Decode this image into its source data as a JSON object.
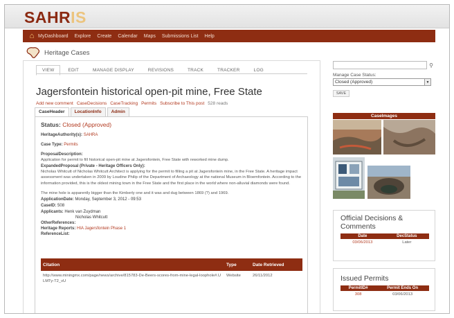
{
  "app": {
    "logo_main": "SAHR",
    "logo_accent": "IS"
  },
  "nav": {
    "items": [
      "MyDashboard",
      "Explore",
      "Create",
      "Calendar",
      "Maps",
      "Submissions List",
      "Help"
    ]
  },
  "section": {
    "title": "Heritage Cases"
  },
  "tabs": [
    "VIEW",
    "EDIT",
    "MANAGE DISPLAY",
    "REVISIONS",
    "TRACK",
    "TRACKER",
    "LOG"
  ],
  "page": {
    "title": "Jagersfontein historical open-pit mine, Free State",
    "actions": [
      "Add new comment",
      "CaseDecisions",
      "CaseTracking",
      "Permits",
      "Subscribe to This post"
    ],
    "reads": "528 reads"
  },
  "subtabs": [
    "CaseHeader",
    "LocationInfo",
    "Admin"
  ],
  "case": {
    "status_label": "Status:",
    "status_value": "Closed (Approved)",
    "authority_label": "HeritageAuthority(s):",
    "authority_value": "SAHRA",
    "casetype_label": "Case Type:",
    "casetype_value": "Permits",
    "proposal_label": "ProposalDescription:",
    "proposal_text": "Application for permit to fill historical open-pit mine at Jagersfontein, Free State with reworked mine dump.",
    "expanded_label": "ExpandedProposal (Private - Heritage Officers Only):",
    "expanded_text_1": "Nicholas Whitcutt of Nicholas Whitcutt Architect is applying for the permit to filling a pit at Jagersfontein mine, in the Free State. A heritage impact assessment was undertaken in 2009 by Loudine Philip of the Department of Archaeology at the national Museum in Bloemfontein. According to the information provided, this is the oldest mining town in the Free State and the first place in the world where non-alluvial diamonds were found.",
    "expanded_text_2": "The mine hole is apparently bigger than the Kimberly one and it was and dug between 1869 (?) and 1969.",
    "appdate_label": "ApplicationDate:",
    "appdate_value": "Monday, September 3, 2012 - 09:53",
    "caseid_label": "CaseID:",
    "caseid_value": "508",
    "applicants_label": "Applicants:",
    "applicant_1": "Henk van Zuydman",
    "applicant_2": "Nicholas Whitcutt",
    "other_refs_label": "OtherReferences:",
    "heritage_reports_label": "Heritage Reports:",
    "heritage_reports_value": "HIA Jagersfontein Phase 1",
    "reference_list_label": "ReferenceList:"
  },
  "citations": {
    "headers": [
      "Citation",
      "Type",
      "Date Retrieved"
    ],
    "rows": [
      {
        "citation": "http://www.miningmx.com/page/news/archive/815783-De-Beers-scores-from-mine-legal-loophole#.ULMTy-T2_vU",
        "type": "Website",
        "date": "26/11/2012"
      }
    ]
  },
  "sidebar": {
    "search_placeholder": "",
    "manage_label": "Manage Case Status:",
    "manage_value": "Closed (Approved)",
    "save_label": "SAVE",
    "images_header": "CaseImages",
    "decisions_title": "Official Decisions & Comments",
    "decisions_headers": [
      "Date",
      "DecStatus"
    ],
    "decisions_rows": [
      {
        "date": "03/06/2013",
        "status": "Later"
      }
    ],
    "permits_title": "Issued Permits",
    "permits_headers": [
      "PermitID#",
      "Permit Ends On"
    ],
    "permits_rows": [
      {
        "id": "308",
        "ends": "03/06/2013"
      }
    ]
  },
  "colors": {
    "brand": "#8e2d12",
    "link": "#b23a20",
    "logo_accent": "#ecc47e"
  }
}
